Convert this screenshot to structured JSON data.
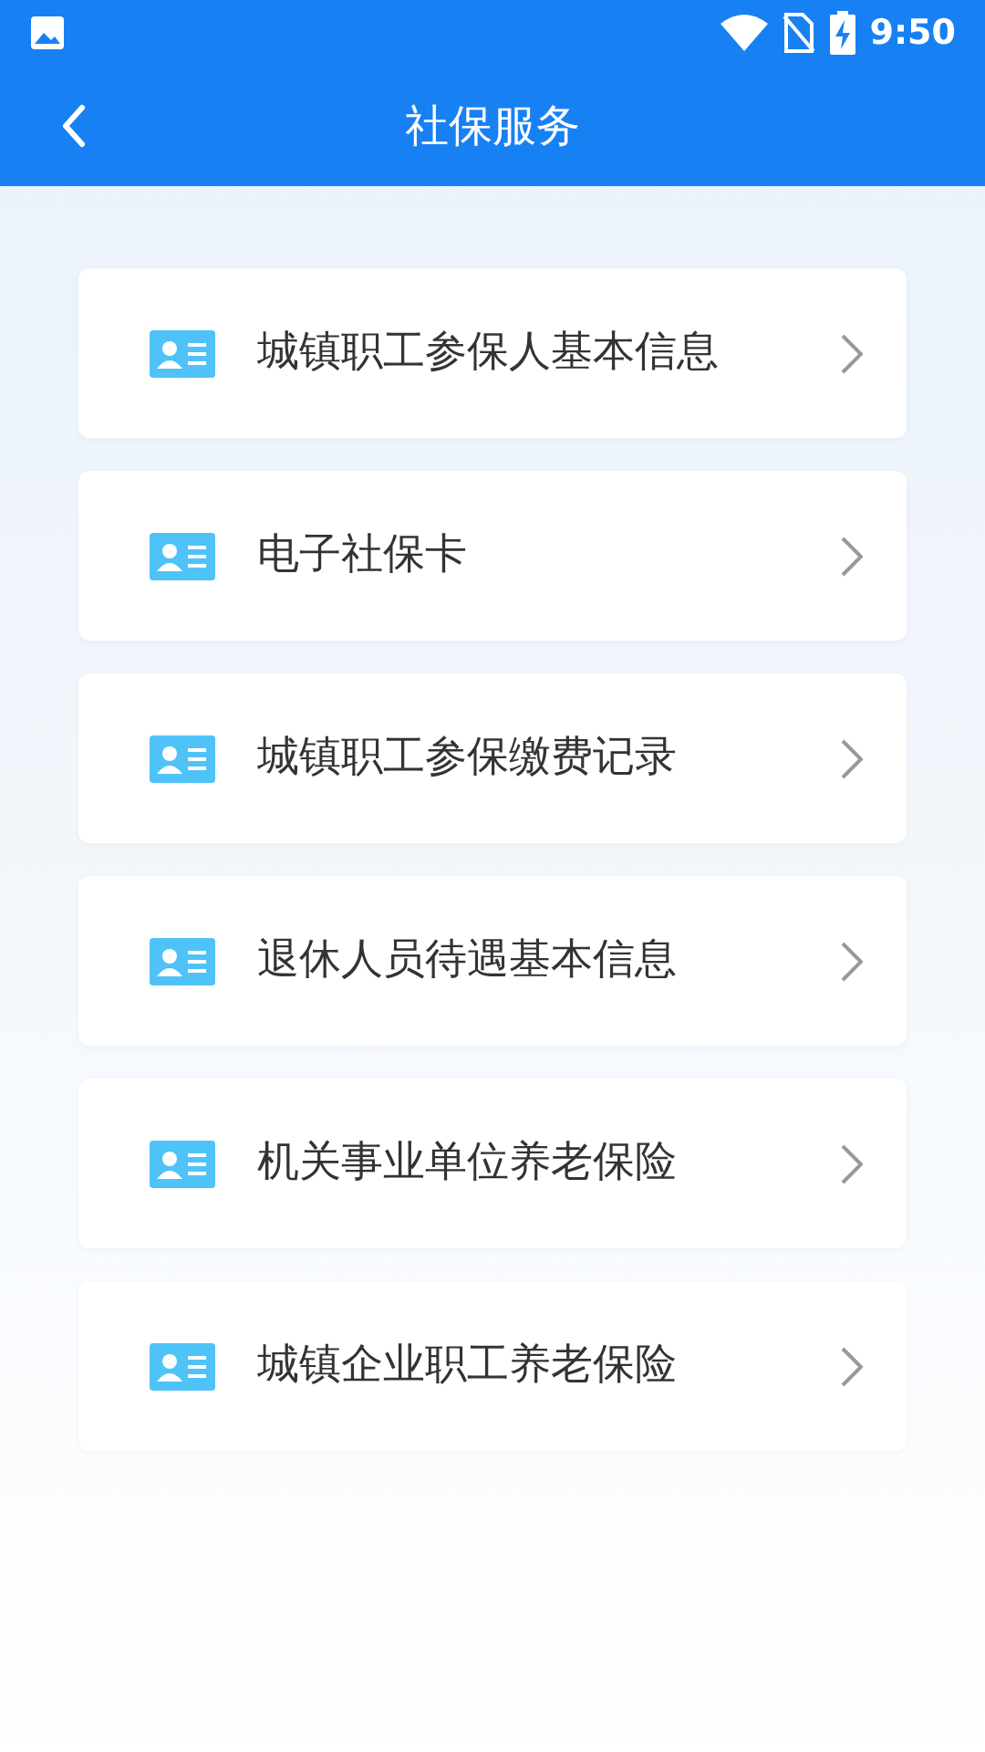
{
  "status_bar": {
    "time": "9:50"
  },
  "header": {
    "title": "社保服务"
  },
  "menu_items": [
    {
      "label": "城镇职工参保人基本信息"
    },
    {
      "label": "电子社保卡"
    },
    {
      "label": "城镇职工参保缴费记录"
    },
    {
      "label": "退休人员待遇基本信息"
    },
    {
      "label": "机关事业单位养老保险"
    },
    {
      "label": "城镇企业职工养老保险"
    }
  ]
}
